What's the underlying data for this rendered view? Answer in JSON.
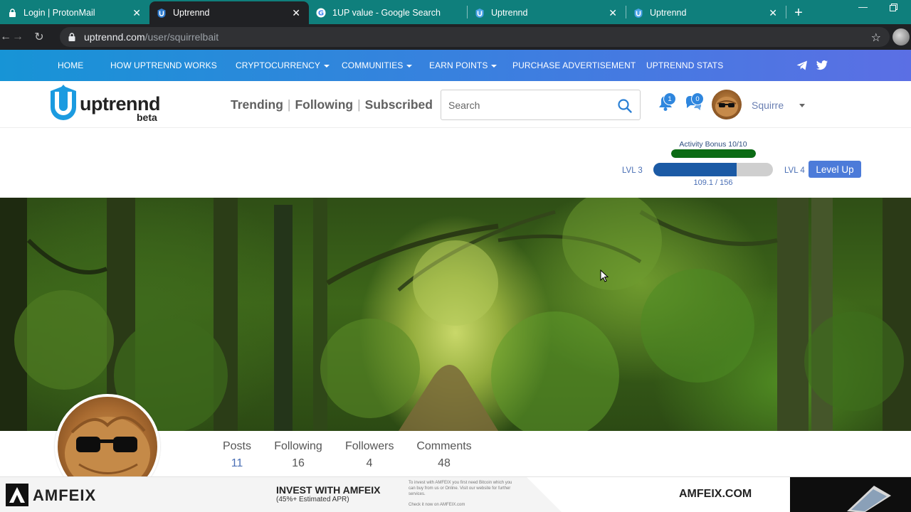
{
  "browser": {
    "tabs": [
      {
        "title": "Login | ProtonMail",
        "icon": "lock-icon",
        "active": false
      },
      {
        "title": "Uptrennd",
        "icon": "uptrennd-favicon",
        "active": true
      },
      {
        "title": "1UP value - Google Search",
        "icon": "google-icon",
        "active": false
      },
      {
        "title": "Uptrennd",
        "icon": "uptrennd-favicon",
        "active": false
      },
      {
        "title": "Uptrennd",
        "icon": "uptrennd-favicon",
        "active": false
      }
    ],
    "close_glyph": "✕",
    "new_tab_glyph": "+",
    "url_host": "uptrennd.com",
    "url_path": "/user/squirrelbait"
  },
  "site_nav": {
    "items": [
      {
        "label": "HOME",
        "dropdown": false
      },
      {
        "label": "HOW UPTRENND WORKS",
        "dropdown": false
      },
      {
        "label": "CRYPTOCURRENCY",
        "dropdown": true
      },
      {
        "label": "COMMUNITIES",
        "dropdown": true
      },
      {
        "label": "EARN POINTS",
        "dropdown": true
      },
      {
        "label": "PURCHASE ADVERTISEMENT",
        "dropdown": false
      },
      {
        "label": "UPTRENND STATS",
        "dropdown": false
      }
    ],
    "social_icons": [
      "telegram-icon",
      "twitter-icon"
    ]
  },
  "header": {
    "logo_text": "uptrennd",
    "logo_beta": "beta",
    "feed_tabs": [
      "Trending",
      "Following",
      "Subscribed"
    ],
    "search_placeholder": "Search",
    "notifications_count": "1",
    "messages_count": "0",
    "username": "Squirre"
  },
  "level": {
    "activity_label": "Activity Bonus 10/10",
    "activity_progress": 1.0,
    "current_level": "LVL 3",
    "next_level": "LVL 4",
    "xp_text": "109.1 / 156",
    "xp_progress": 0.699,
    "level_up_label": "Level Up"
  },
  "profile_stats": [
    {
      "label": "Posts",
      "value": "11"
    },
    {
      "label": "Following",
      "value": "16"
    },
    {
      "label": "Followers",
      "value": "4"
    },
    {
      "label": "Comments",
      "value": "48"
    }
  ],
  "ad": {
    "brand": "AMFEIX",
    "headline": "INVEST WITH AMFEIX",
    "subline": "(45%+ Estimated APR)",
    "fine_print": "To invest with AMFEIX you first need Bitcoin which you can buy from us or Online. Visit our website for further services.",
    "fine_print_2": "Check it now on AMFEIX.com",
    "domain": "AMFEIX.COM"
  },
  "colors": {
    "tabbar": "#0f7f7c",
    "nav_gradient_start": "#1794d6",
    "nav_gradient_end": "#5b6fe4",
    "activity_fill": "#0b6b14",
    "xp_fill": "#1b5aa5",
    "level_up_button": "#4c7bd9",
    "stat_value": "#4a6fb5"
  }
}
